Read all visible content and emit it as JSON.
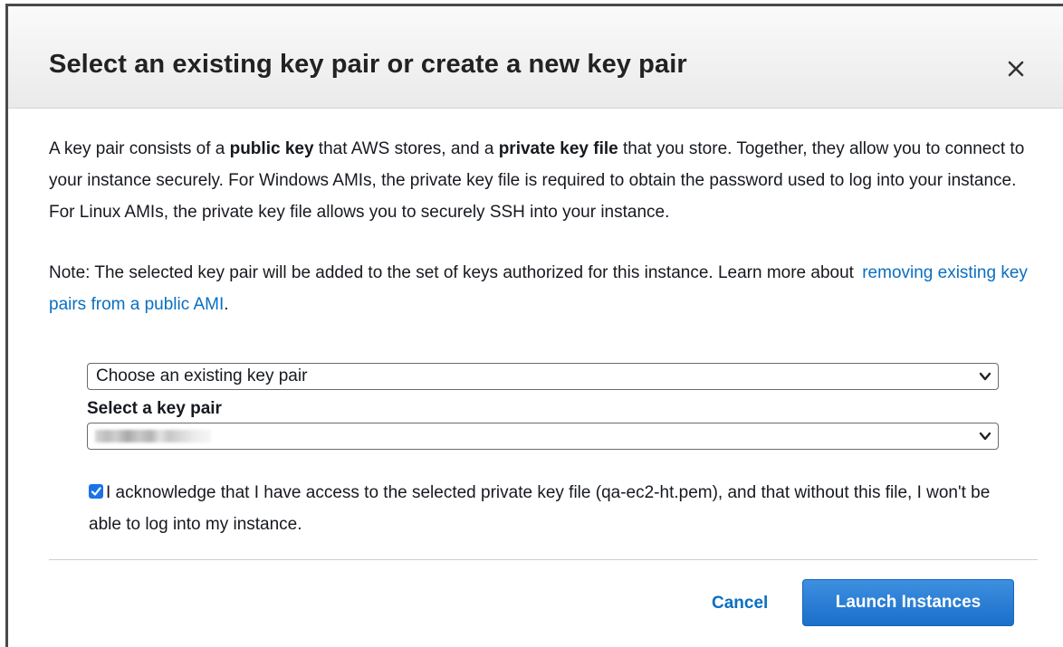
{
  "dialog": {
    "title": "Select an existing key pair or create a new key pair",
    "close_icon": "close-icon"
  },
  "description": {
    "part1": "A key pair consists of a ",
    "bold1": "public key",
    "part2": " that AWS stores, and a ",
    "bold2": "private key file",
    "part3": " that you store. Together, they allow you to connect to your instance securely. For Windows AMIs, the private key file is required to obtain the password used to log into your instance. For Linux AMIs, the private key file allows you to securely SSH into your instance."
  },
  "note": {
    "text": "Note: The selected key pair will be added to the set of keys authorized for this instance. Learn more about",
    "link": "removing existing key pairs from a public AMI",
    "suffix": "."
  },
  "key_pair_option": {
    "selected": "Choose an existing key pair",
    "chevron_icon": "chevron-down-icon"
  },
  "key_pair_select": {
    "label": "Select a key pair",
    "selected": "",
    "chevron_icon": "chevron-down-icon"
  },
  "acknowledge": {
    "checked": true,
    "text": "I acknowledge that I have access to the selected private key file (qa-ec2-ht.pem), and that without this file, I won't be able to log into my instance."
  },
  "footer": {
    "cancel_label": "Cancel",
    "launch_label": "Launch Instances"
  },
  "colors": {
    "link": "#0a6fc2",
    "primary_button": "#1b6fc9",
    "checkbox": "#1a73e8"
  }
}
